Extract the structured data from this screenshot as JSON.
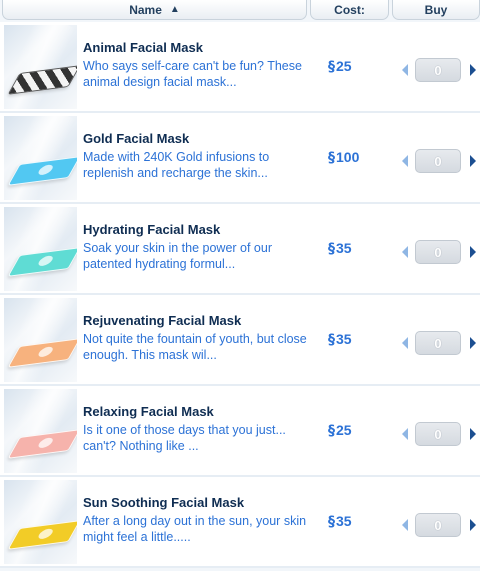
{
  "header": {
    "name_label": "Name",
    "cost_label": "Cost:",
    "buy_label": "Buy",
    "sort_icon": "sort-ascending-icon"
  },
  "currency_symbol": "§",
  "items": [
    {
      "title": "Animal Facial Mask",
      "description": "Who says self-care can't be fun? These animal design facial mask...",
      "price": "25",
      "quantity": "0",
      "pad_color": "#e8e8e8",
      "pad_style": "zebra"
    },
    {
      "title": "Gold Facial Mask",
      "description": "Made with 240K Gold infusions to replenish and recharge the skin...",
      "price": "100",
      "quantity": "0",
      "pad_color": "#52c8f2",
      "pad_style": "solid"
    },
    {
      "title": "Hydrating Facial Mask",
      "description": "Soak your skin in the power of our patented hydrating formul...",
      "price": "35",
      "quantity": "0",
      "pad_color": "#5fdcd4",
      "pad_style": "solid"
    },
    {
      "title": "Rejuvenating Facial Mask",
      "description": "Not quite the fountain of youth, but close enough. This mask wil...",
      "price": "35",
      "quantity": "0",
      "pad_color": "#f7b27e",
      "pad_style": "solid"
    },
    {
      "title": "Relaxing Facial Mask",
      "description": "Is it one of those days that you just... can't? Nothing like ...",
      "price": "25",
      "quantity": "0",
      "pad_color": "#f6b3ac",
      "pad_style": "solid"
    },
    {
      "title": "Sun Soothing Facial Mask",
      "description": "After a long day out in the sun, your skin might feel a little.....",
      "price": "35",
      "quantity": "0",
      "pad_color": "#f2cc27",
      "pad_style": "solid"
    }
  ]
}
